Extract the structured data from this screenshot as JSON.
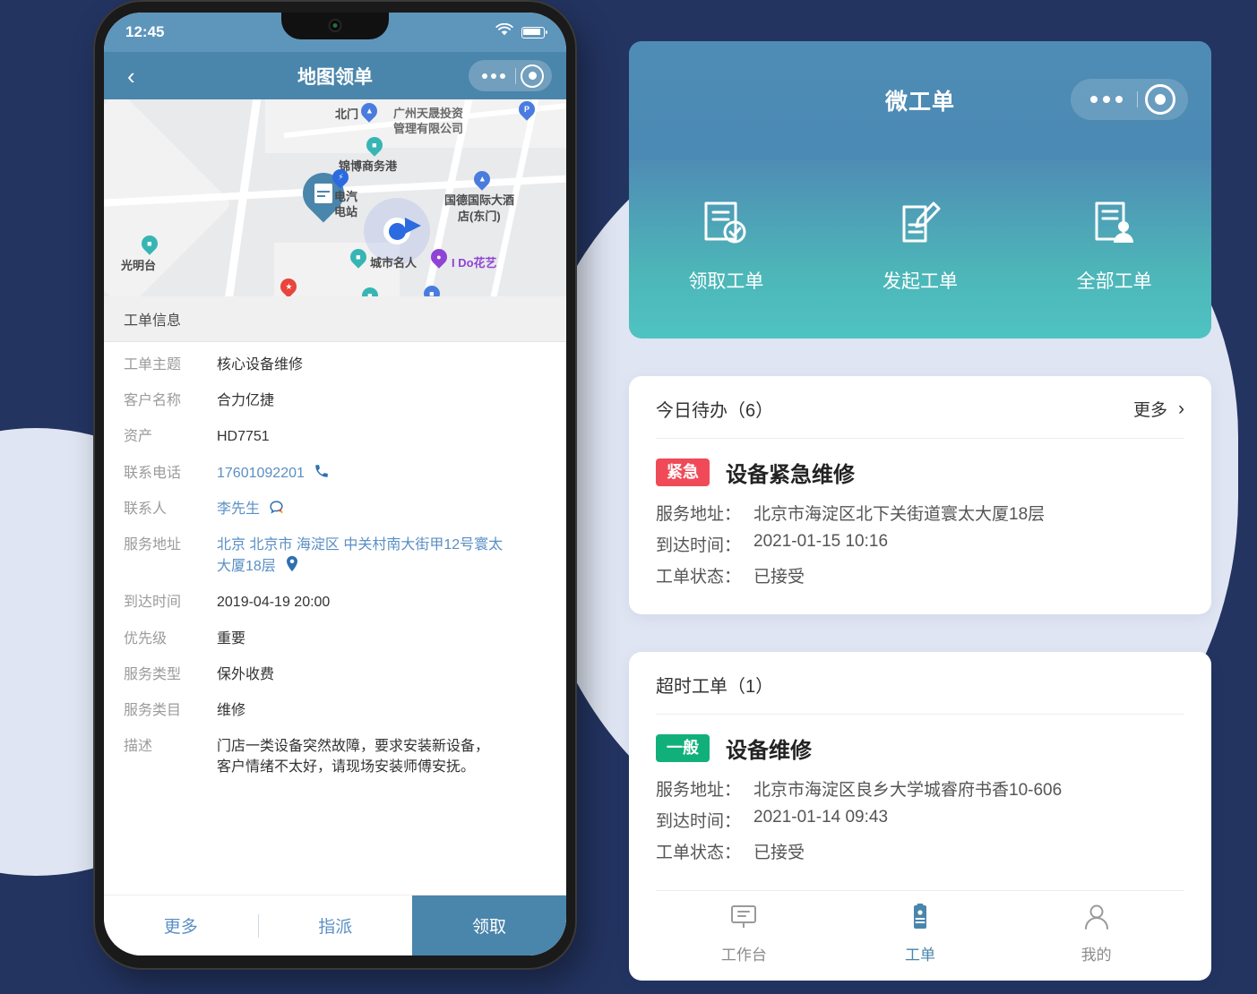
{
  "colors": {
    "page_bg": "#233461",
    "bg_circle": "#dfe5f2",
    "phone_navbar": "#4a85ab",
    "phone_statusbar": "#5e95bb",
    "accent_blue": "#4a85ab",
    "link_blue": "#5a8fc4",
    "badge_urgent": "#f04a59",
    "badge_normal": "#11b07a",
    "mp_gradient_top": "#4f8cb5",
    "mp_gradient_bottom": "#4ec3c1"
  },
  "phone": {
    "status_bar": {
      "time": "12:45",
      "wifi_icon": "wifi-icon",
      "battery_icon": "battery-icon"
    },
    "navbar": {
      "back_icon": "chevron-left-icon",
      "title": "地图领单",
      "capsule": {
        "more_icon": "more-dots-icon",
        "target_icon": "target-icon"
      }
    },
    "map": {
      "pois": [
        {
          "label": "北门",
          "icon": "subway-pin-icon"
        },
        {
          "label": "广州天晟投资",
          "icon": "text-label"
        },
        {
          "label": "管理有限公司",
          "icon": "text-label"
        },
        {
          "label": "锦博商务港",
          "icon": "building-pin-icon"
        },
        {
          "label": "电汽",
          "icon": "text-label"
        },
        {
          "label": "电站",
          "icon": "text-label"
        },
        {
          "label": "国德国际大酒",
          "icon": "text-label"
        },
        {
          "label": "店(东门)",
          "icon": "text-label"
        },
        {
          "label": "光明台",
          "icon": "building-pin-icon"
        },
        {
          "label": "城市名人",
          "icon": "building-pin-icon"
        },
        {
          "label": "I Do花艺",
          "icon": "shop-pin-icon"
        }
      ],
      "parking_icon": "parking-pin-icon",
      "order_pin_icon": "work-order-pin-icon",
      "charging_icon": "charging-bolt-icon",
      "restaurant_icon": "restaurant-pin-icon",
      "current_location_icon": "current-location-icon"
    },
    "section_title": "工单信息",
    "details": [
      {
        "label": "工单主题",
        "value": "核心设备维修",
        "link": false,
        "icon": ""
      },
      {
        "label": "客户名称",
        "value": "合力亿捷",
        "link": false,
        "icon": ""
      },
      {
        "label": "资产",
        "value": "HD7751",
        "link": false,
        "icon": ""
      },
      {
        "label": "联系电话",
        "value": "17601092201",
        "link": true,
        "icon": "phone-icon"
      },
      {
        "label": "联系人",
        "value": "李先生",
        "link": true,
        "icon": "chat-icon"
      },
      {
        "label": "服务地址",
        "value": "北京 北京市 海淀区 中关村南大街甲12号寰太大厦18层",
        "link": true,
        "icon": "location-pin-icon"
      },
      {
        "label": "到达时间",
        "value": "2019-04-19 20:00",
        "link": false,
        "icon": ""
      },
      {
        "label": "优先级",
        "value": "重要",
        "link": false,
        "icon": ""
      },
      {
        "label": "服务类型",
        "value": "保外收费",
        "link": false,
        "icon": ""
      },
      {
        "label": "服务类目",
        "value": "维修",
        "link": false,
        "icon": ""
      },
      {
        "label": "描述",
        "value": "门店一类设备突然故障，要求安装新设备，客户情绪不太好，请现场安装师傅安抚。",
        "link": false,
        "icon": ""
      }
    ],
    "bottom_bar": {
      "more_label": "更多",
      "assign_label": "指派",
      "claim_label": "领取"
    }
  },
  "mini_program": {
    "header": {
      "title": "微工单",
      "capsule": {
        "more_icon": "more-dots-icon",
        "target_icon": "target-icon"
      }
    },
    "actions": [
      {
        "label": "领取工单",
        "icon": "doc-check-icon"
      },
      {
        "label": "发起工单",
        "icon": "doc-edit-icon"
      },
      {
        "label": "全部工单",
        "icon": "doc-person-icon"
      }
    ],
    "today_card": {
      "title": "今日待办（6）",
      "more_label": "更多",
      "more_icon": "chevron-right-icon",
      "item": {
        "badge": "紧急",
        "badge_color": "#f04a59",
        "title": "设备紧急维修",
        "lines": [
          {
            "key": "服务地址：",
            "value": "北京市海淀区北下关街道寰太大厦18层"
          },
          {
            "key": "到达时间：",
            "value": "2021-01-15 10:16"
          },
          {
            "key": "工单状态：",
            "value": "已接受"
          }
        ]
      }
    },
    "overdue_card": {
      "title": "超时工单（1）",
      "item": {
        "badge": "一般",
        "badge_color": "#11b07a",
        "title": "设备维修",
        "lines": [
          {
            "key": "服务地址：",
            "value": "北京市海淀区良乡大学城睿府书香10-606"
          },
          {
            "key": "到达时间：",
            "value": "2021-01-14 09:43"
          },
          {
            "key": "工单状态：",
            "value": "已接受"
          }
        ]
      }
    },
    "tabbar": [
      {
        "label": "工作台",
        "icon": "workbench-icon",
        "active": false
      },
      {
        "label": "工单",
        "icon": "clipboard-icon",
        "active": true
      },
      {
        "label": "我的",
        "icon": "person-icon",
        "active": false
      }
    ]
  }
}
